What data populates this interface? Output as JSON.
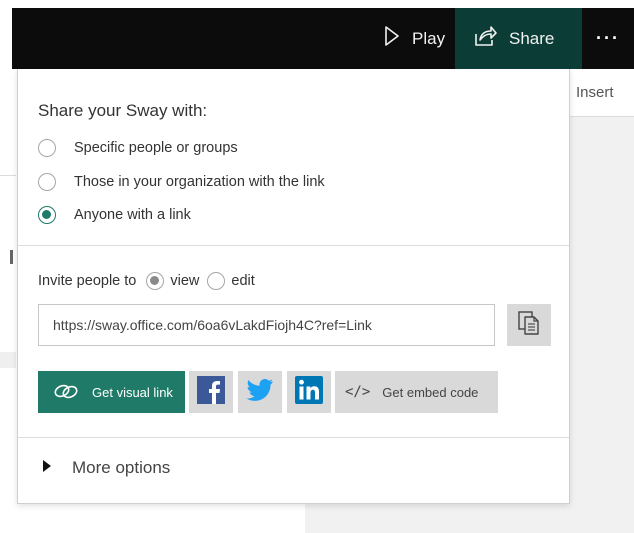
{
  "toolbar": {
    "play_label": "Play",
    "share_label": "Share",
    "more_label": "···",
    "insert_label": "Insert"
  },
  "share_panel": {
    "heading": "Share your Sway with:",
    "audience_options": [
      {
        "label": "Specific people or groups",
        "selected": false
      },
      {
        "label": "Those in your organization with the link",
        "selected": false
      },
      {
        "label": "Anyone with a link",
        "selected": true
      }
    ],
    "invite": {
      "prefix": "Invite people to",
      "options": [
        {
          "label": "view",
          "selected": true
        },
        {
          "label": "edit",
          "selected": false
        }
      ]
    },
    "link_url": "https://sway.office.com/6oa6vLakdFiojh4C?ref=Link",
    "visual_link_label": "Get visual link",
    "embed_label": "Get embed code",
    "embed_glyph": "</>",
    "more_options_label": "More options"
  },
  "colors": {
    "accent": "#1f7a68",
    "share_active": "#0b3d36",
    "topbar": "#0c0c0c",
    "facebook": "#3b5998",
    "twitter": "#1da1f2",
    "linkedin": "#0077b5"
  },
  "icons": {
    "play": "play-icon",
    "share": "share-icon",
    "copy": "copy-icon",
    "visual_link": "link-icon",
    "facebook": "facebook-icon",
    "twitter": "twitter-icon",
    "linkedin": "linkedin-icon",
    "expand": "triangle-right-icon"
  }
}
